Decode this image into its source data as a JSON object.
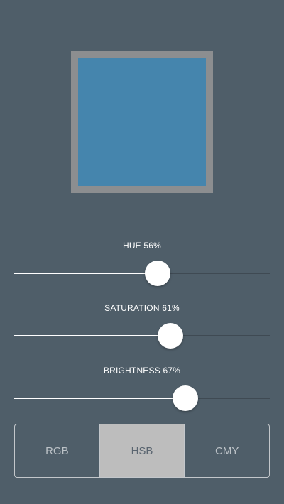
{
  "swatch": {
    "color": "#4585ad",
    "frame_color": "#8c8e90"
  },
  "sliders": [
    {
      "id": "hue",
      "label": "HUE 56%",
      "value": 0.56
    },
    {
      "id": "saturation",
      "label": "SATURATION 61%",
      "value": 0.61
    },
    {
      "id": "brightness",
      "label": "BRIGHTNESS 67%",
      "value": 0.67
    }
  ],
  "mode_selector": {
    "options": [
      "RGB",
      "HSB",
      "CMY"
    ],
    "selected": "HSB"
  }
}
